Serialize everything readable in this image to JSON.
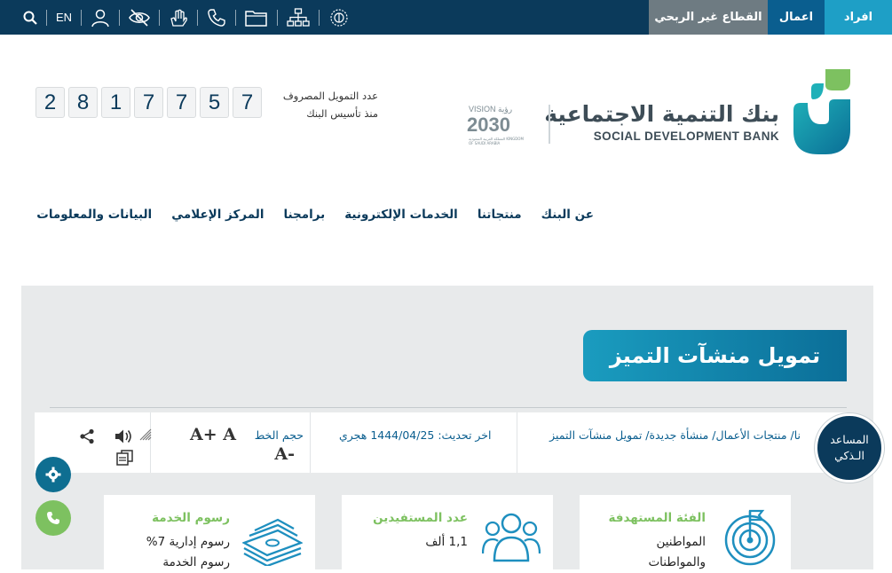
{
  "topbar": {
    "tabs": [
      "افراد",
      "اعمال",
      "القطاع غير الربحي"
    ],
    "lang": "EN"
  },
  "header": {
    "bank_name_ar": "بنك التنمية الاجتماعية",
    "bank_name_en": "SOCIAL DEVELOPMENT BANK",
    "vision_top": "VISION رؤية",
    "vision_year": "2030",
    "vision_sub": "المملكة العربية السعودية KINGDOM OF SAUDI ARABIA",
    "counter_label_1": "عدد التمويل المصروف",
    "counter_label_2": "منذ تأسيس البنك",
    "digits": [
      "7",
      "5",
      "7",
      "7",
      "1",
      "8",
      "2"
    ]
  },
  "nav": {
    "items": [
      "عن البنك",
      "منتجاتنا",
      "الخدمات الإلكترونية",
      "برامجنا",
      "المركز الإعلامي",
      "البيانات والمعلومات"
    ]
  },
  "page": {
    "title": "تمويل منشآت التميز",
    "breadcrumb": "نا/ منتجات الأعمال/ منشأة جديدة/ تمويل منشآت التميز",
    "updated": "اخر تحديث: 1444/04/25 هجري",
    "font_size_label": "حجم الخط",
    "font_big": "A+ A",
    "font_small": "A-"
  },
  "assistant": {
    "line1": "المساعد",
    "line2": "الـذكي"
  },
  "cards": [
    {
      "title": "الفئة المستهدفة",
      "value_1": "المواطنين",
      "value_2": "والمواطنات",
      "icon": "target-icon"
    },
    {
      "title": "عدد المستفيدين",
      "value_1": "1,1 ألف",
      "value_2": "",
      "icon": "people-icon"
    },
    {
      "title": "رسوم الخدمة",
      "value_1": "رسوم إدارية 7%",
      "value_2": "رسوم الخدمة",
      "icon": "money-stack-icon"
    }
  ],
  "colors": {
    "navy": "#0b3a5b",
    "teal": "#1e9fc6",
    "green": "#7dc160"
  }
}
